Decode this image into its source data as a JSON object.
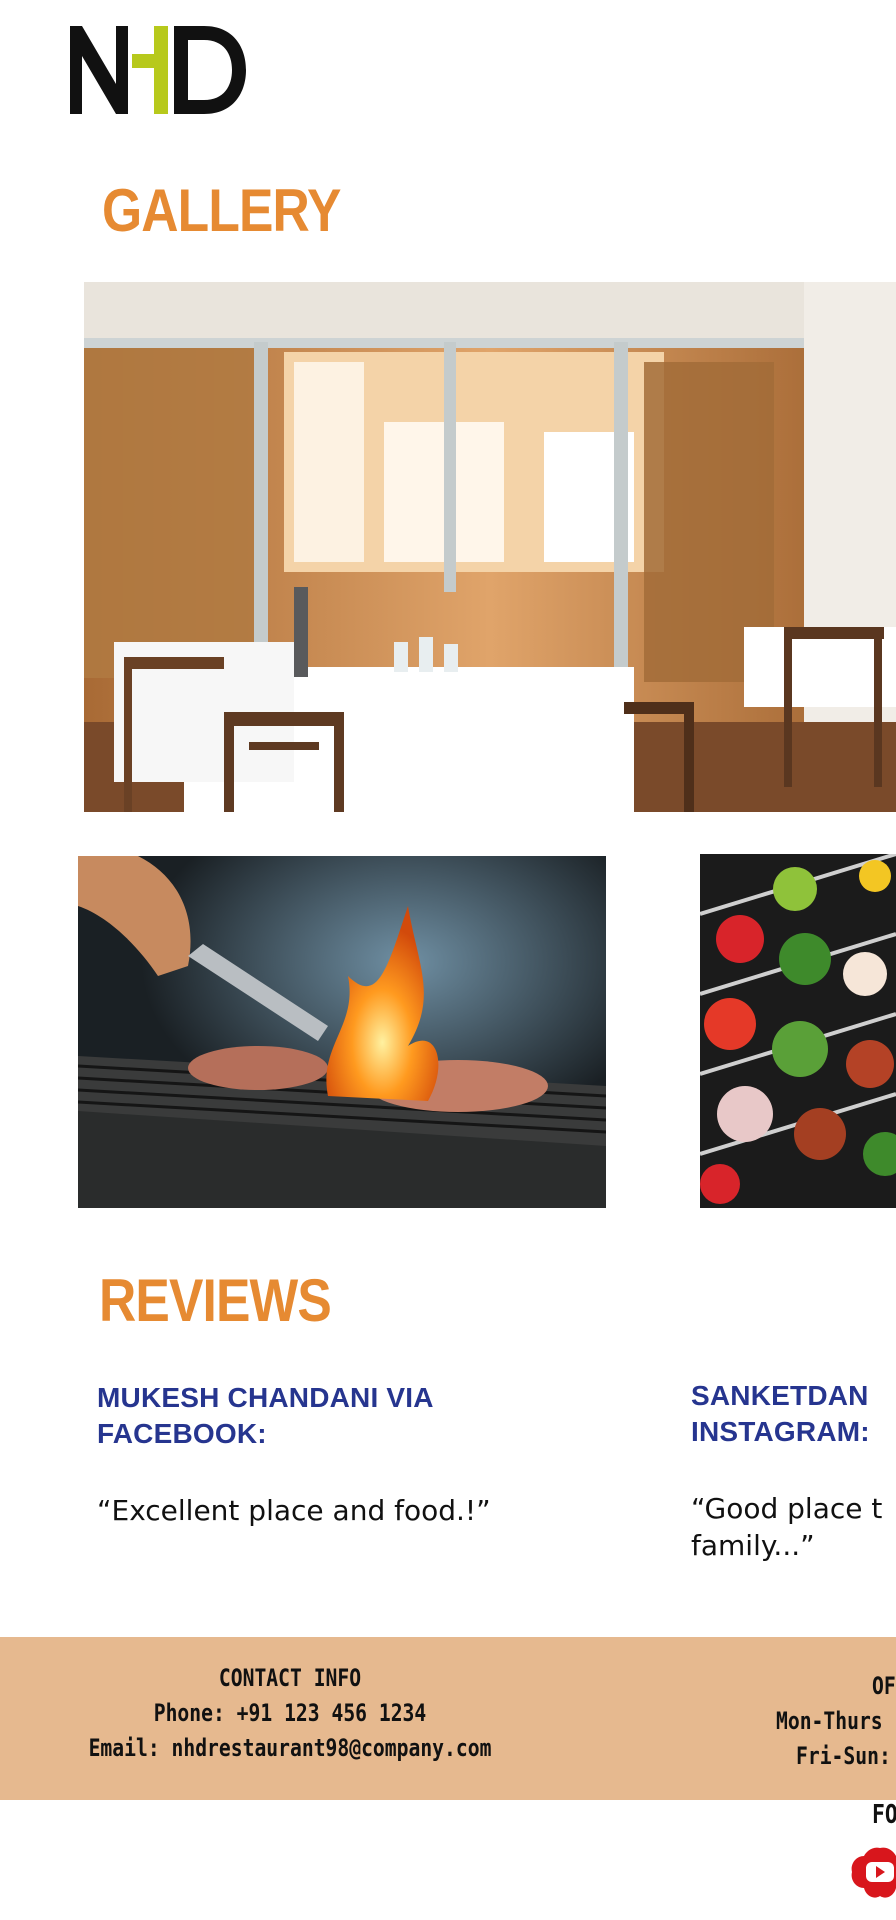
{
  "brand": {
    "logo_text": "NHD",
    "colors": {
      "dark": "#111111",
      "accent": "#b7c91c"
    }
  },
  "gallery": {
    "title": "GALLERY",
    "title_color": "#e68a32",
    "images": [
      {
        "name": "restaurant-dining-room-photo"
      },
      {
        "name": "grill-flames-photo"
      },
      {
        "name": "vegetable-skewers-photo"
      }
    ]
  },
  "reviews": {
    "title": "REVIEWS",
    "title_color": "#e68a32",
    "author_color": "#26358f",
    "items": [
      {
        "author": "MUKESH CHANDANI VIA FACEBOOK:",
        "quote": "“Excellent place and food.!”"
      },
      {
        "author_line1": "SANKETDAN",
        "author_line2": "INSTAGRAM:",
        "quote_line1": "“Good place t",
        "quote_line2": "family...”"
      }
    ]
  },
  "footer": {
    "background": "#e6b98f",
    "contact": {
      "title": "CONTACT INFO",
      "phone": "Phone: +91 123 456 1234",
      "email": "Email: nhdrestaurant98@company.com"
    },
    "hours": {
      "title": "OF",
      "weekday": "Mon-Thurs",
      "weekend": "Fri-Sun: "
    }
  },
  "follow": {
    "label": "FO",
    "icons": [
      "youtube-icon"
    ]
  }
}
